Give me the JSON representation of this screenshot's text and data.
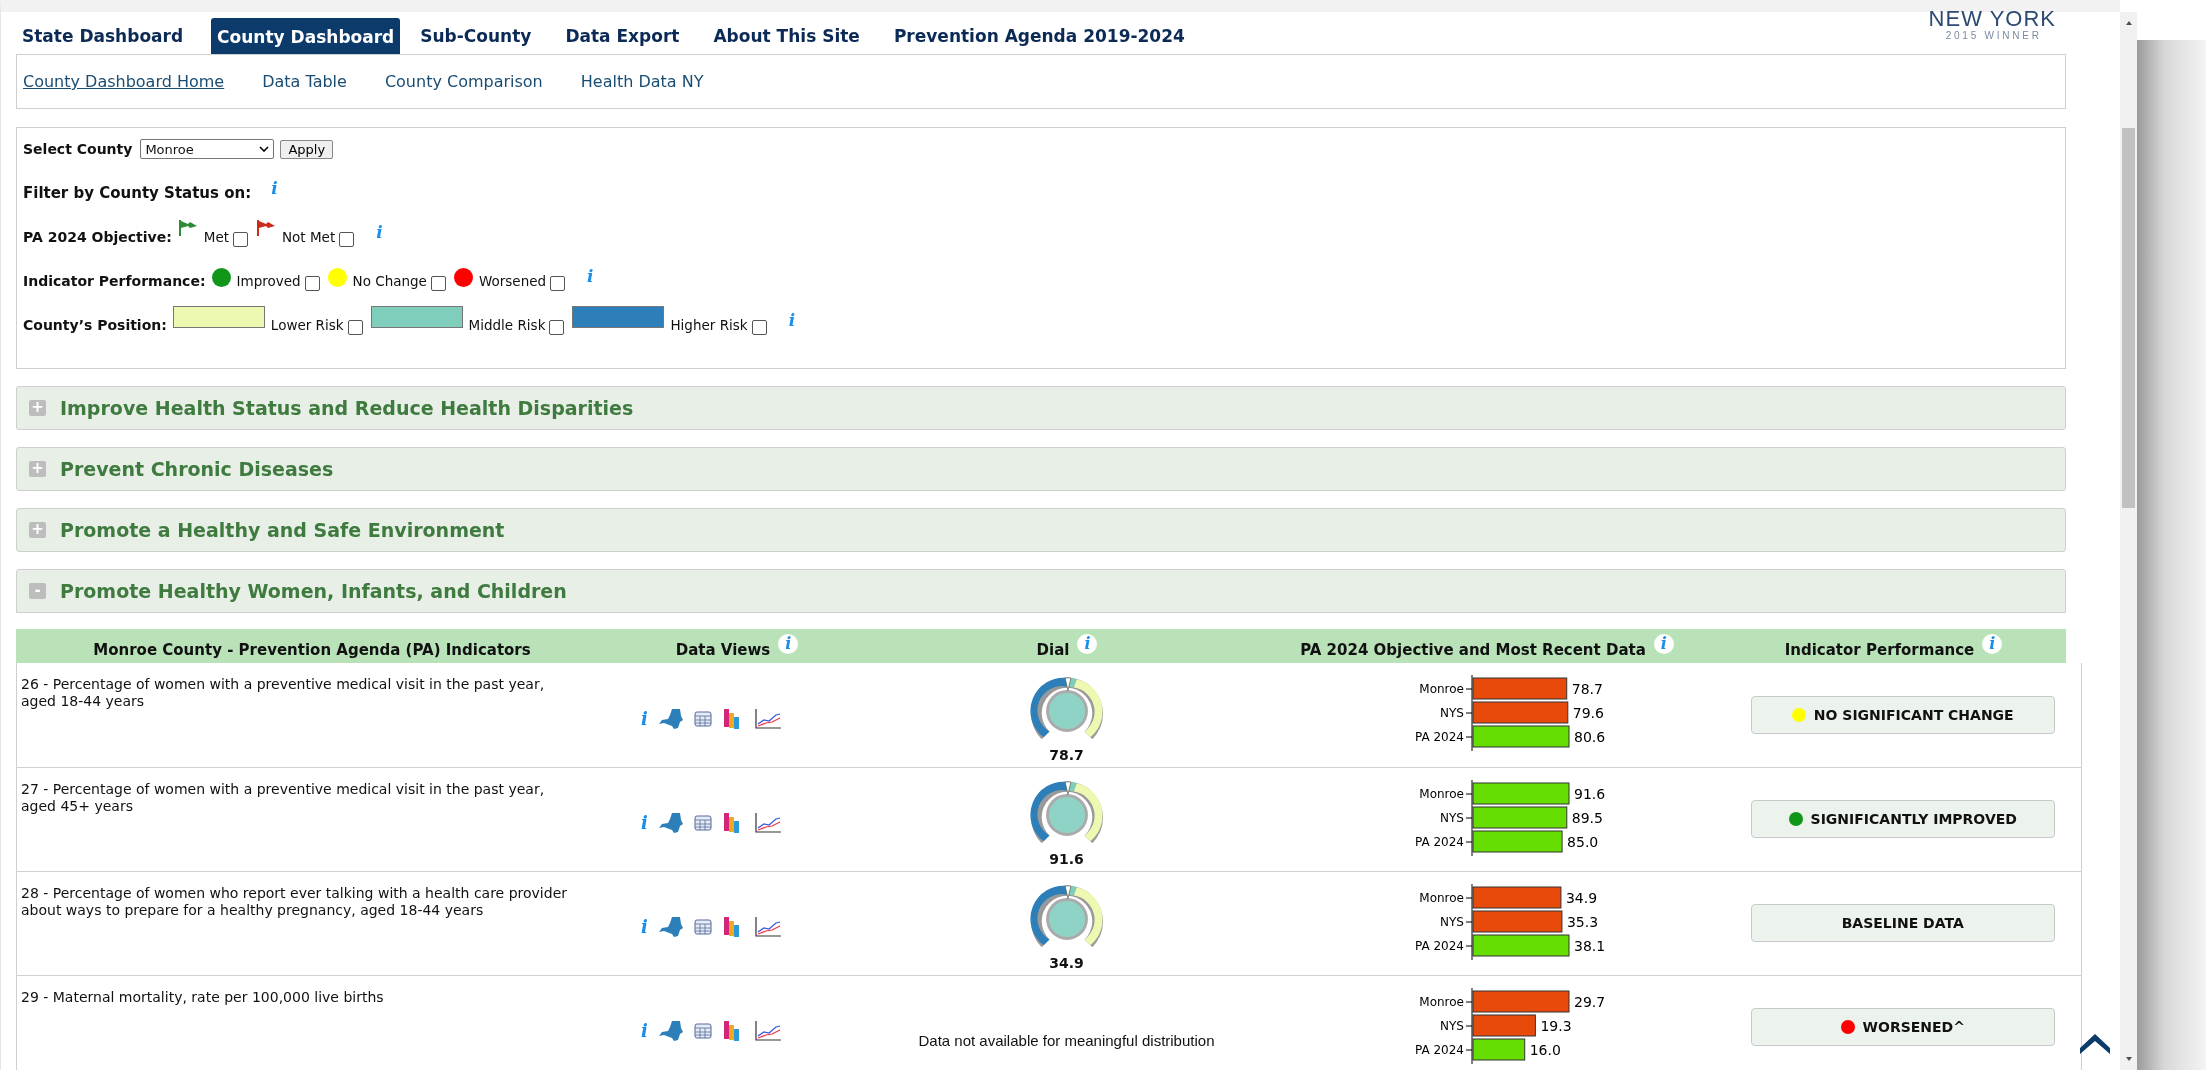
{
  "top_tabs": [
    {
      "label": "State Dashboard",
      "selected": false
    },
    {
      "label": "County Dashboard",
      "selected": true
    },
    {
      "label": "Sub-County",
      "selected": false
    },
    {
      "label": "Data Export",
      "selected": false
    },
    {
      "label": "About This Site",
      "selected": false
    },
    {
      "label": "Prevention Agenda 2019-2024",
      "selected": false
    }
  ],
  "logo": {
    "title": "NEW YORK",
    "subtitle": "2 0 1 5   W I N N E R"
  },
  "sub_nav": [
    {
      "label": "County Dashboard Home",
      "selected": true
    },
    {
      "label": "Data Table",
      "selected": false
    },
    {
      "label": "County Comparison",
      "selected": false
    },
    {
      "label": "Health Data NY",
      "selected": false
    }
  ],
  "filters": {
    "county_label": "Select County",
    "county_value": "Monroe",
    "apply_button": "Apply",
    "status_heading": "Filter by County Status on:",
    "status_info": "i",
    "groups": [
      {
        "label": "PA 2024 Objective:",
        "info": "i",
        "options": [
          {
            "kind": "flag",
            "color": "#2e8b3a",
            "label": "Met",
            "checked": false
          },
          {
            "kind": "flag",
            "color": "#cc2a1a",
            "label": "Not Met",
            "checked": false
          }
        ]
      },
      {
        "label": "Indicator Performance:",
        "info": "i",
        "options": [
          {
            "kind": "dot",
            "color": "#109618",
            "label": "Improved",
            "checked": false
          },
          {
            "kind": "dot",
            "color": "#ffff00",
            "label": "No Change",
            "checked": false
          },
          {
            "kind": "dot",
            "color": "#ff0000",
            "label": "Worsened",
            "checked": false
          }
        ]
      },
      {
        "label": "County’s Position:",
        "info": "i",
        "options": [
          {
            "kind": "swatch",
            "color": "#edf8b1",
            "label": "Lower Risk",
            "checked": false
          },
          {
            "kind": "swatch",
            "color": "#7fcdbb",
            "label": "Middle Risk",
            "checked": false
          },
          {
            "kind": "swatch",
            "color": "#2c7fb8",
            "label": "Higher Risk",
            "checked": false
          }
        ]
      }
    ]
  },
  "sections": [
    {
      "toggle": "+",
      "title": "Improve Health Status and Reduce Health Disparities",
      "expanded": false
    },
    {
      "toggle": "+",
      "title": "Prevent Chronic Diseases",
      "expanded": false
    },
    {
      "toggle": "+",
      "title": "Promote a Healthy and Safe Environment",
      "expanded": false
    },
    {
      "toggle": "-",
      "title": "Promote Healthy Women, Infants, and Children",
      "expanded": true
    }
  ],
  "table": {
    "columns": [
      {
        "label": "Monroe County - Prevention Agenda (PA) Indicators"
      },
      {
        "label": "Data Views",
        "info": "i"
      },
      {
        "label": "Dial",
        "info": "i"
      },
      {
        "label": "PA 2024 Objective and Most Recent Data",
        "info": "i"
      },
      {
        "label": "Indicator Performance",
        "info": "i"
      }
    ],
    "rows": [
      {
        "indicator": "26 - Percentage of women with a preventive medical visit in the past year, aged 18-44 years",
        "info": "i",
        "dial": "78.7",
        "chart_data": {
          "type": "bar",
          "orientation": "horizontal",
          "categories": [
            "Monroe",
            "NYS",
            "PA 2024"
          ],
          "values": [
            78.7,
            79.6,
            80.6
          ],
          "colors": [
            "#e84a0c",
            "#e84a0c",
            "#66dd00"
          ],
          "value_labels": [
            "78.7",
            "79.6",
            "80.6"
          ]
        },
        "performance": {
          "label": "NO SIGNIFICANT CHANGE",
          "color": "#ffff00"
        }
      },
      {
        "indicator": "27 - Percentage of women with a preventive medical visit in the past year, aged 45+ years",
        "info": "i",
        "dial": "91.6",
        "chart_data": {
          "type": "bar",
          "orientation": "horizontal",
          "categories": [
            "Monroe",
            "NYS",
            "PA 2024"
          ],
          "values": [
            91.6,
            89.5,
            85.0
          ],
          "colors": [
            "#66dd00",
            "#66dd00",
            "#66dd00"
          ],
          "value_labels": [
            "91.6",
            "89.5",
            "85.0"
          ]
        },
        "performance": {
          "label": "SIGNIFICANTLY IMPROVED",
          "color": "#109618"
        }
      },
      {
        "indicator": "28 - Percentage of women who report ever talking with a health care provider about ways to prepare for a healthy pregnancy, aged 18-44 years",
        "info": "i",
        "dial": "34.9",
        "chart_data": {
          "type": "bar",
          "orientation": "horizontal",
          "categories": [
            "Monroe",
            "NYS",
            "PA 2024"
          ],
          "values": [
            34.9,
            35.3,
            38.1
          ],
          "colors": [
            "#e84a0c",
            "#e84a0c",
            "#66dd00"
          ],
          "value_labels": [
            "34.9",
            "35.3",
            "38.1"
          ]
        },
        "performance": {
          "label": "BASELINE DATA"
        }
      },
      {
        "indicator": "29 - Maternal mortality, rate per 100,000 live births",
        "info": "i",
        "dial_note": "Data not available for meaningful distribution",
        "chart_data": {
          "type": "bar",
          "orientation": "horizontal",
          "categories": [
            "Monroe",
            "NYS",
            "PA 2024"
          ],
          "values": [
            29.7,
            19.3,
            16.0
          ],
          "colors": [
            "#e84a0c",
            "#e84a0c",
            "#66dd00"
          ],
          "value_labels": [
            "29.7",
            "19.3",
            "16.0"
          ]
        },
        "performance": {
          "label": "WORSENED^",
          "color": "#ff0000"
        }
      }
    ]
  }
}
